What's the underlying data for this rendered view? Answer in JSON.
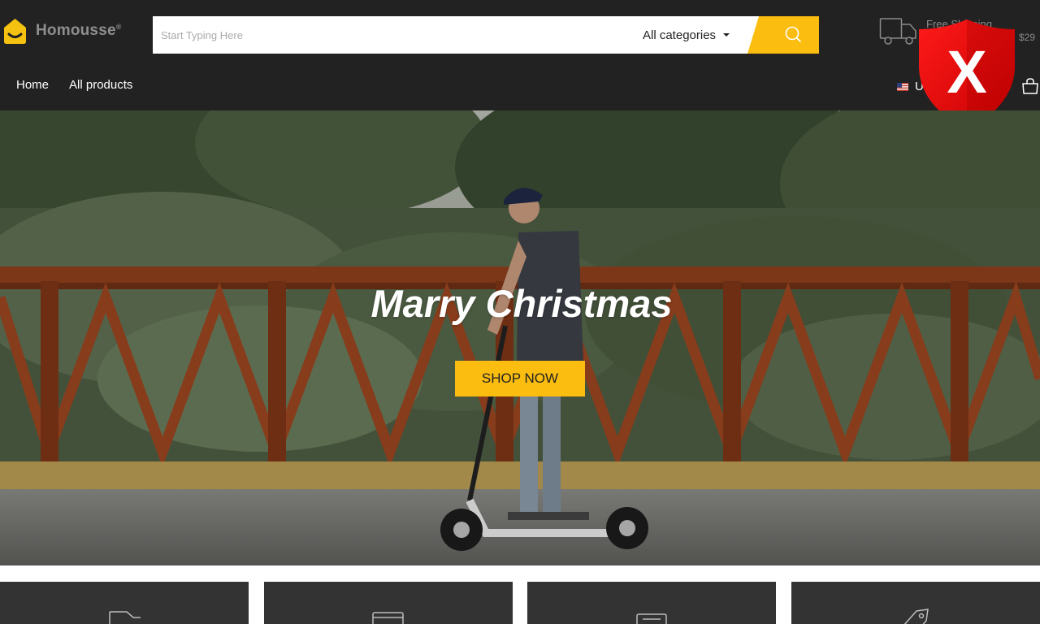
{
  "brand": {
    "name": "Homousse",
    "reg_mark": "®",
    "logo_color": "#f5c211"
  },
  "search": {
    "placeholder": "Start Typing Here",
    "value": "",
    "category_selected": "All categories",
    "button_icon": "search-icon",
    "button_color": "#fbbd10"
  },
  "shipping": {
    "icon": "truck-icon",
    "title": "Free Shipping",
    "subtitle": "$29"
  },
  "nav": {
    "items": [
      {
        "label": "Home"
      },
      {
        "label": "All products"
      }
    ]
  },
  "currency": {
    "flag_icon": "us-flag-icon",
    "label": "US"
  },
  "cart": {
    "icon": "shopping-bag-icon"
  },
  "overlay_badge": {
    "icon": "red-shield-x-icon",
    "color": "#e40000",
    "glyph": "X"
  },
  "hero": {
    "title": "Marry Christmas",
    "cta_label": "SHOP NOW",
    "cta_color": "#fbbd10",
    "image": "man-on-electric-scooter-bridge"
  },
  "features": [
    {
      "icon": "delivery-box-icon"
    },
    {
      "icon": "credit-card-icon"
    },
    {
      "icon": "message-icon"
    },
    {
      "icon": "price-tag-icon"
    }
  ],
  "colors": {
    "header_bg": "#222222",
    "card_bg": "#333333",
    "accent": "#fbbd10"
  }
}
